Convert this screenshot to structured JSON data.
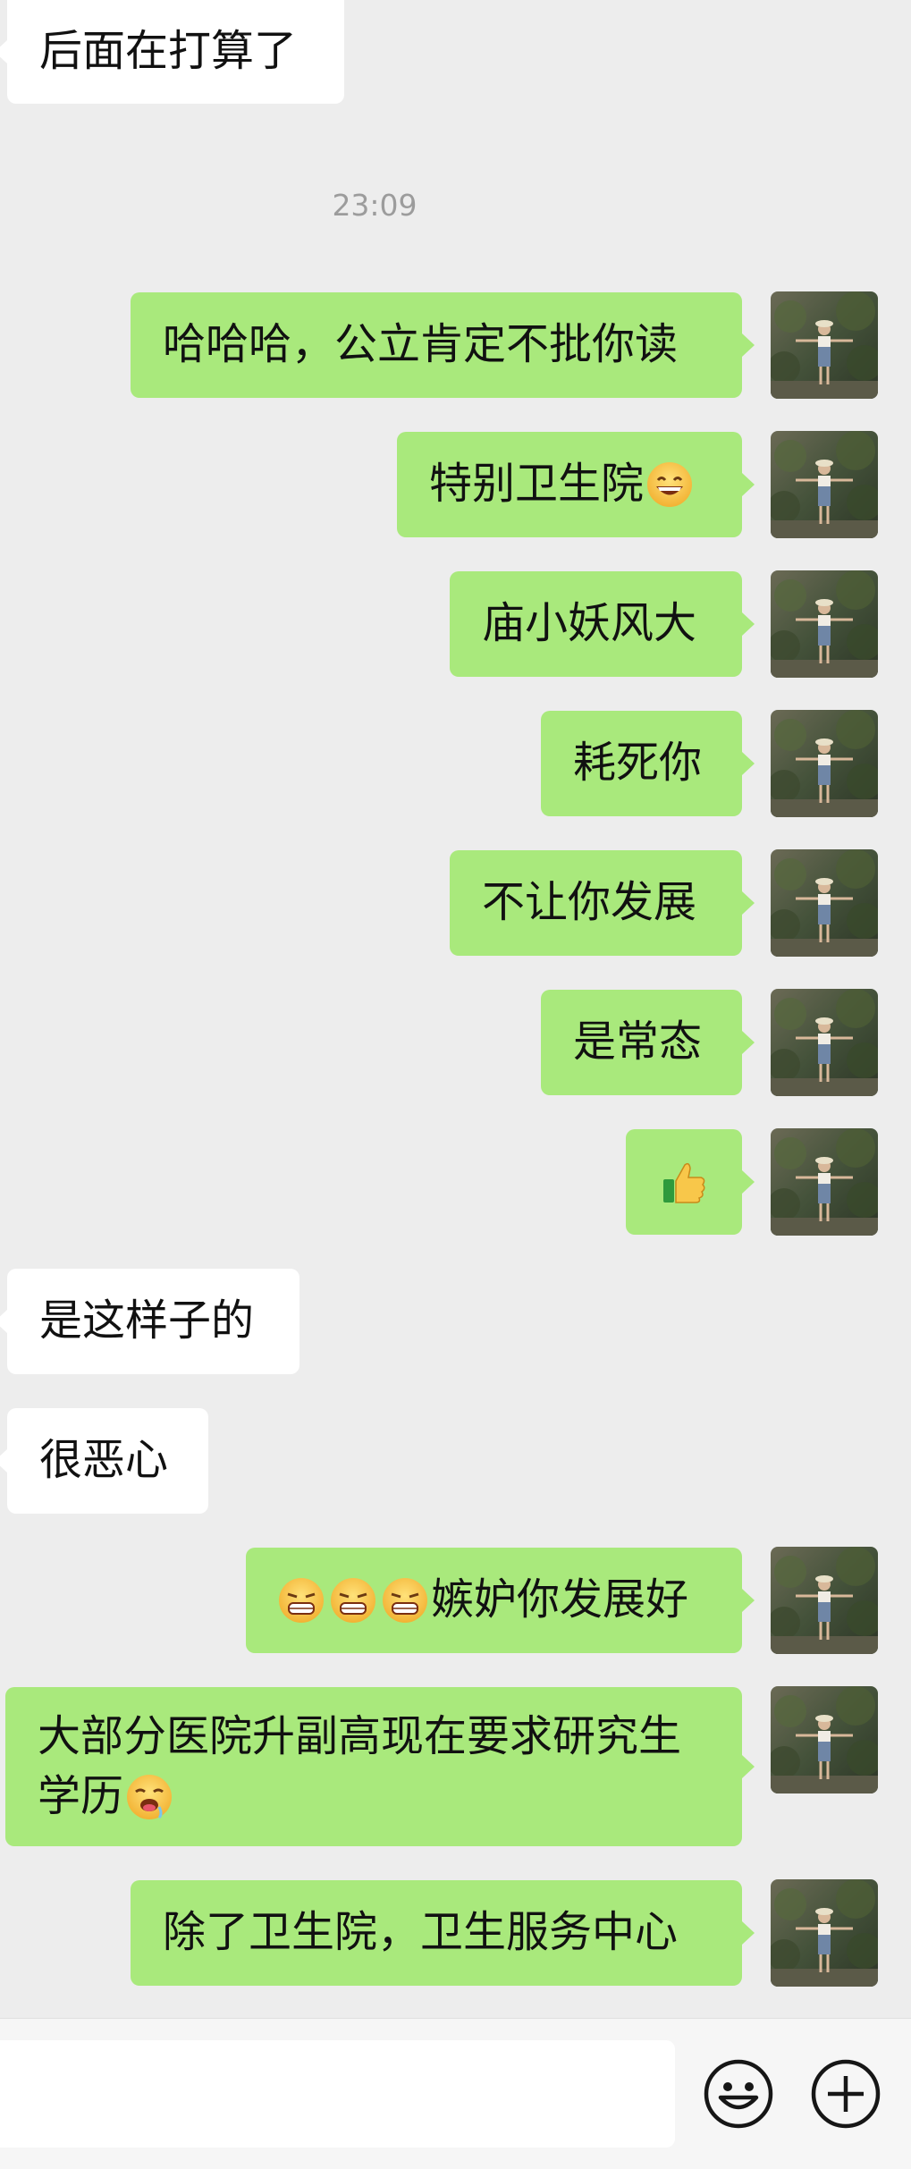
{
  "timestamp": "23:09",
  "messages": [
    {
      "side": "left",
      "text": "后面在打算了"
    },
    {
      "side": "right",
      "text": "哈哈哈，公立肯定不批你读"
    },
    {
      "side": "right",
      "text": "特别卫生院",
      "emoji": "grin-emoji"
    },
    {
      "side": "right",
      "text": "庙小妖风大"
    },
    {
      "side": "right",
      "text": "耗死你"
    },
    {
      "side": "right",
      "text": "不让你发展"
    },
    {
      "side": "right",
      "text": "是常态"
    },
    {
      "side": "right",
      "text": "",
      "emoji": "thumbs-up-emoji"
    },
    {
      "side": "left",
      "text": "是这样子的"
    },
    {
      "side": "left",
      "text": "很恶心"
    },
    {
      "side": "right",
      "text": "嫉妒你发展好",
      "emoji": "smirk-emoji x3"
    },
    {
      "side": "right",
      "text_line1": "大部分医院升副高现在要求研究生",
      "text_line2": "学历",
      "emoji": "drool-emoji"
    },
    {
      "side": "right",
      "text": "除了卫生院，卫生服务中心"
    }
  ],
  "colors": {
    "background": "#ededed",
    "own_bubble": "#a9e97c",
    "other_bubble": "#ffffff",
    "timestamp": "#9c9c9c"
  },
  "input_bar": {
    "emoji_button_icon": "smiley-icon",
    "plus_button_icon": "plus-circle-icon"
  }
}
